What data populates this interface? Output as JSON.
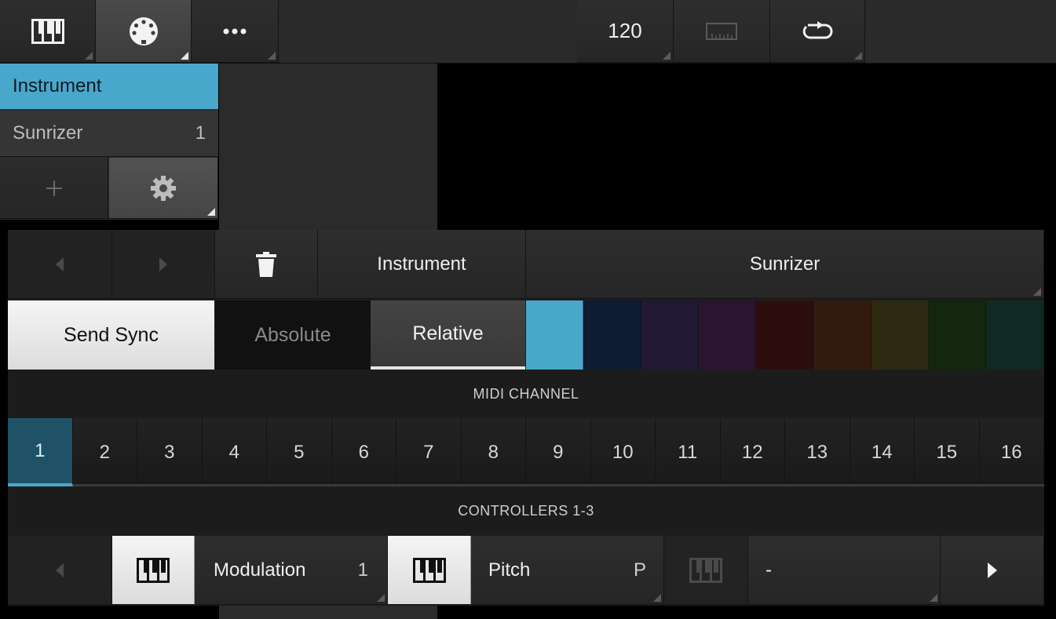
{
  "topbar": {
    "keyboard_icon": "piano-keys-icon",
    "midi_icon": "midi-din-icon",
    "more_icon": "more-dots-icon",
    "tempo": "120",
    "metronome_icon": "ruler-metronome-icon",
    "loop_icon": "loop-icon"
  },
  "tracks": {
    "selected_label": "Instrument",
    "items": [
      {
        "name": "Sunrizer",
        "channel": "1"
      }
    ],
    "add_icon": "plus-icon",
    "settings_icon": "gear-icon"
  },
  "panel": {
    "trash_icon": "trash-icon",
    "type_label": "Instrument",
    "name_label": "Sunrizer",
    "send_sync_label": "Send Sync",
    "mode_absolute": "Absolute",
    "mode_relative": "Relative",
    "colors": [
      "#4aa7cc",
      "#0f1a33",
      "#211833",
      "#2a1530",
      "#2d0e0e",
      "#321a0e",
      "#2c2a10",
      "#14260e",
      "#0e2a22"
    ],
    "midi_channel_title": "MIDI CHANNEL",
    "channels": [
      "1",
      "2",
      "3",
      "4",
      "5",
      "6",
      "7",
      "8",
      "9",
      "10",
      "11",
      "12",
      "13",
      "14",
      "15",
      "16"
    ],
    "selected_channel": "1",
    "controllers_title": "CONTROLLERS 1-3",
    "controllers": [
      {
        "name": "Modulation",
        "value": "1"
      },
      {
        "name": "Pitch",
        "value": "P"
      },
      {
        "name": "-",
        "value": ""
      }
    ]
  }
}
